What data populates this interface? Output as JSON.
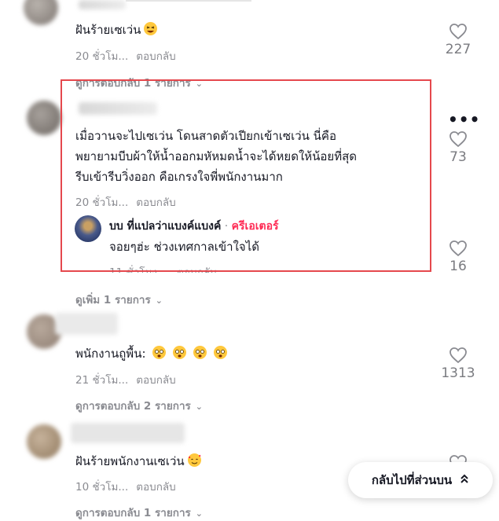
{
  "comments": [
    {
      "text": "ฝันร้ายเซเว่น",
      "time": "20 ชั่วโม...",
      "reply_label": "ตอบกลับ",
      "likes": "227",
      "view_replies": "ดูการตอบกลับ 1 รายการ",
      "emoji": "laughing-face"
    },
    {
      "line1": "เมื่อวานจะไปเซเว่น โดนสาดตัวเปียกเข้าเซเว่น นี่คือ",
      "line2": "พยายามบีบผ้าให้น้ำออกมหัหมดน้ำจะได้หยดให้น้อยที่สุด",
      "line3": "รีบเข้ารีบวิ่งออก คือเกรงใจพี่พนักงานมาก",
      "time": "20 ชั่วโม...",
      "reply_label": "ตอบกลับ",
      "likes": "73",
      "reply": {
        "author": "บบ ที่แปลว่าแบงค์แบงค์",
        "separator": "·",
        "badge": "ครีเอเตอร์",
        "text": "จอยๆฮ่ะ ช่วงเทศกาลเข้าใจได้",
        "time": "11 ชั่วโมง...",
        "reply_label": "ตอบกลับ",
        "likes": "16"
      },
      "view_more": "ดูเพิ่ม 1 รายการ"
    },
    {
      "text": "พนักงานถูพื้น:",
      "time": "21 ชั่วโม...",
      "reply_label": "ตอบกลับ",
      "likes": "1313",
      "view_replies": "ดูการตอบกลับ 2 รายการ",
      "emoji": "drooling-face"
    },
    {
      "text": "ฝันร้ายพนักงานเซเว่น",
      "time": "10 ชั่วโม...",
      "reply_label": "ตอบกลับ",
      "view_replies": "ดูการตอบกลับ 1 รายการ",
      "emoji": "smiling-face-with-hearts"
    }
  ],
  "back_to_top": "กลับไปที่ส่วนบน",
  "colors": {
    "creator_badge": "#fe2c55",
    "highlight": "#e5484d",
    "muted": "#8a8b91"
  }
}
